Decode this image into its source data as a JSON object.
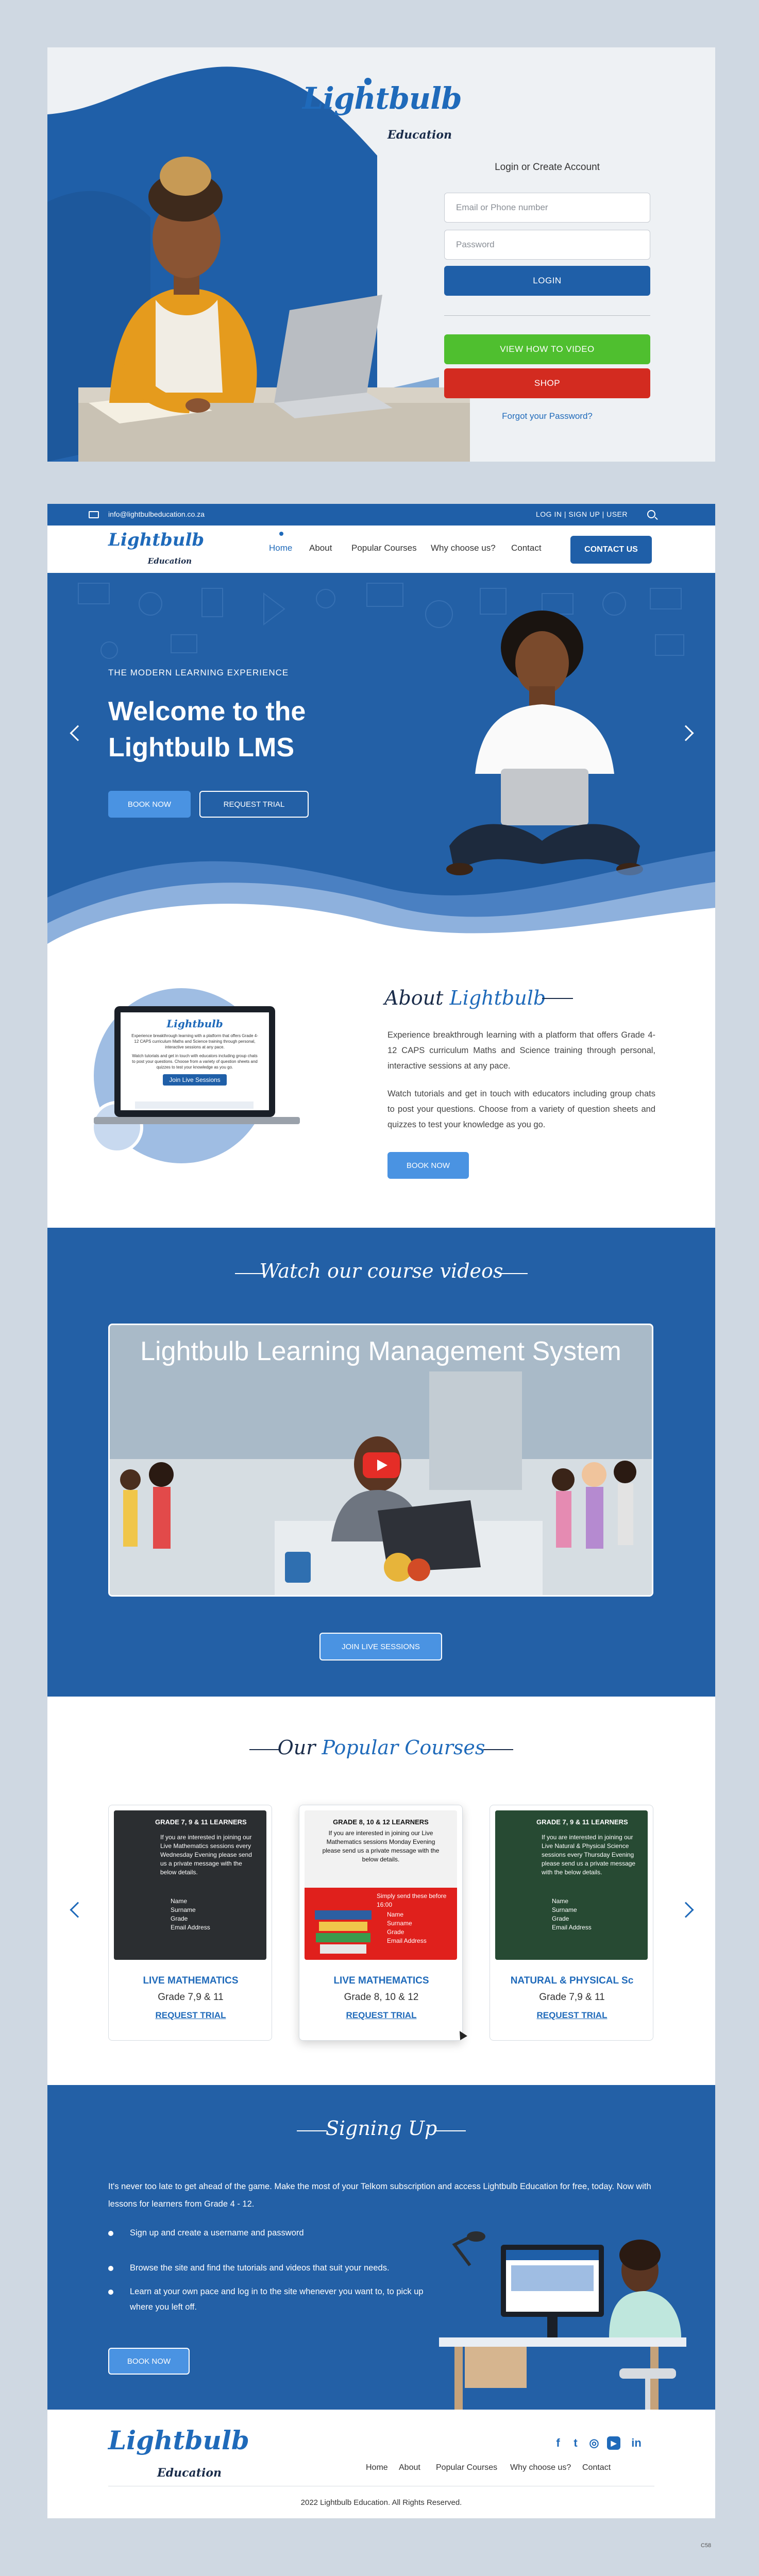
{
  "login": {
    "logo_script": "Lightbulb",
    "logo_sub": "Education",
    "heading": "Login or Create Account",
    "email_placeholder": "Email or Phone number",
    "password_placeholder": "Password",
    "login_button": "LOGIN",
    "video_button": "VIEW HOW TO VIDEO",
    "shop_button": "SHOP",
    "forgot_link": "Forgot your Password?"
  },
  "topbar": {
    "email": "info@lightbulbeducation.co.za",
    "links": "LOG IN   |   SIGN UP   |   USER"
  },
  "nav": {
    "logo_script": "Lightbulb",
    "logo_sub": "Education",
    "items": [
      "Home",
      "About",
      "Popular Courses",
      "Why choose us?",
      "Contact"
    ],
    "contact_button": "CONTACT US"
  },
  "hero": {
    "kicker": "THE MODERN LEARNING EXPERIENCE",
    "title": "Welcome to the Lightbulb LMS",
    "book_button": "BOOK NOW",
    "trial_button": "REQUEST TRIAL"
  },
  "about": {
    "title_plain": "About ",
    "title_highlight": "Lightbulb",
    "para1": "Experience breakthrough learning with a platform that offers Grade 4-12 CAPS curriculum Maths and Science training through personal, interactive sessions at any pace.",
    "para2": "Watch tutorials and get in touch with educators including group chats to post your questions. Choose from a variety of question sheets and quizzes to test your knowledge as you go.",
    "book_button": "BOOK NOW",
    "laptop_logo": "Lightbulb",
    "laptop_text": "Experience breakthrough learning with a platform that offers Grade 4-12 CAPS curriculum Maths and Science training through personal, interactive sessions at any pace.",
    "laptop_text2": "Watch tutorials and get in touch with educators including group chats to post your questions. Choose from a variety of question sheets and quizzes to test your knowledge as you go.",
    "laptop_button": "Join Live Sessions"
  },
  "videos": {
    "title": "Watch our course videos",
    "video_title": "Lightbulb Learning Management System",
    "live_button": "JOIN LIVE SESSIONS"
  },
  "courses": {
    "title_plain": "Our ",
    "title_highlight": "Popular Courses",
    "items": [
      {
        "name": "LIVE MATHEMATICS",
        "grade": "Grade 7,9 & 11",
        "link": "REQUEST TRIAL",
        "img_heading": "GRADE 7, 9 & 11 LEARNERS",
        "img_text": "If you are interested in joining our Live Mathematics sessions every Wednesday Evening please send us a private message with the below details.",
        "img_list": [
          "Name",
          "Surname",
          "Grade",
          "Email Address"
        ]
      },
      {
        "name": "LIVE MATHEMATICS",
        "grade": "Grade 8, 10 & 12",
        "link": "REQUEST TRIAL",
        "img_heading": "GRADE 8, 10 & 12 LEARNERS",
        "img_text": "If you are interested in joining our Live Mathematics sessions Monday Evening please send us a private message with the below details.",
        "img_list": [
          "Name",
          "Surname",
          "Grade",
          "Email Address"
        ],
        "img_callout": "Simply send these before 16:00"
      },
      {
        "name": "NATURAL & PHYSICAL Sc",
        "grade": "Grade 7,9 & 11",
        "link": "REQUEST TRIAL",
        "img_heading": "GRADE 7, 9 & 11 LEARNERS",
        "img_text": "If you are interested in joining our Live Natural & Physical Science sessions every Thursday Evening please send us a private message with the below details.",
        "img_list": [
          "Name",
          "Surname",
          "Grade",
          "Email Address"
        ]
      }
    ]
  },
  "signing": {
    "title": "Signing Up",
    "intro": "It's never too late to get ahead of the game. Make the most of your Telkom subscription and access Lightbulb Education for free, today. Now with lessons for learners from Grade 4 - 12.",
    "bullets": [
      "Sign up and create a username and password",
      "Browse the site and find the tutorials and videos that suit your needs.",
      "Learn at your own pace and log in to the site whenever you want to, to pick up where you left off."
    ],
    "book_button": "BOOK NOW"
  },
  "footer": {
    "logo_script": "Lightbulb",
    "logo_sub": "Education",
    "nav": [
      "Home",
      "About",
      "Popular Courses",
      "Why choose us?",
      "Contact"
    ],
    "social": [
      "f",
      "t",
      "◎",
      "▶",
      "in"
    ],
    "copyright": "2022 Lightbulb Education. All Rights Reserved."
  },
  "corner_mark": "C58",
  "colors": {
    "brand_blue": "#1f6aba",
    "section_blue": "#2360a6",
    "accent_blue": "#4a93e2",
    "green": "#4fbf2f",
    "red": "#d32b20"
  }
}
